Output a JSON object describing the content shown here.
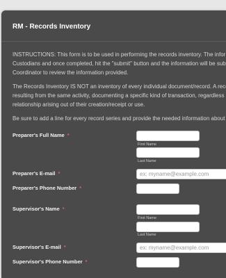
{
  "form": {
    "title": "RM - Records Inventory",
    "paragraphs": [
      [
        "INSTRUCTIONS: This form is to be used in performing the records inventory.  The infor",
        "Custodians and once completed, hit the \"submit\" button and the information will be sub",
        "Coordinator to review the information provided."
      ],
      [
        "The Records Inventory IS NOT an inventory of every individual document/record.  A reco",
        "resulting from the same activity, documenting a specific kind of transaction, regardless",
        "relationship arising out of their creation/receipt or use."
      ],
      [
        "Be sure to add a line for every record series and provide the needed information about"
      ]
    ],
    "required_mark": "*",
    "preparer": {
      "name_label": "Preparer's Full Name",
      "first_sublabel": "First Name",
      "last_sublabel": "Last Name",
      "email_label": "Preparer's E-mail",
      "email_placeholder": "ex: myname@example.com",
      "phone_label": "Preparer's Phone Number"
    },
    "supervisor": {
      "name_label": "Supervisor's Name",
      "first_sublabel": "First Name",
      "last_sublabel": "Last Name",
      "email_label": "Supervisor's E-mail",
      "email_placeholder": "ex: myname@example.com",
      "phone_label": "Supervisor's Phone Number"
    }
  }
}
